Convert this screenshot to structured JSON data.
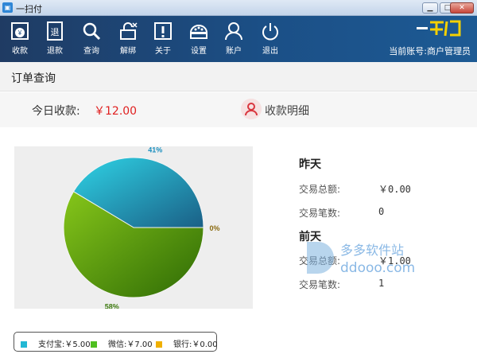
{
  "window": {
    "title": "一扫付",
    "controls": [
      "minimize",
      "maximize",
      "close"
    ]
  },
  "toolbar": {
    "items": [
      {
        "id": "collect",
        "label": "收款",
        "icon": "cash-icon"
      },
      {
        "id": "refund",
        "label": "退款",
        "icon": "refund-icon"
      },
      {
        "id": "query",
        "label": "查询",
        "icon": "search-icon"
      },
      {
        "id": "unbind",
        "label": "解绑",
        "icon": "unbind-icon"
      },
      {
        "id": "about",
        "label": "关于",
        "icon": "info-icon"
      },
      {
        "id": "settings",
        "label": "设置",
        "icon": "settings-icon"
      },
      {
        "id": "account",
        "label": "账户",
        "icon": "user-icon"
      },
      {
        "id": "exit",
        "label": "退出",
        "icon": "power-icon"
      }
    ],
    "brand_text": "一扫付",
    "account_text": "当前账号:商户管理员"
  },
  "page": {
    "title": "订单查询"
  },
  "today": {
    "label": "今日收款:",
    "value": "￥12.00",
    "detail_label": "收款明细"
  },
  "chart_data": {
    "type": "pie",
    "slices": [
      {
        "name": "支付宝",
        "value": 41,
        "label": "41%",
        "color": "#22b8d4"
      },
      {
        "name": "微信",
        "value": 58,
        "label": "58%",
        "color": "#4f9a10"
      },
      {
        "name": "银行",
        "value": 0,
        "label": "0%",
        "color": "#e2b200"
      }
    ],
    "legend": [
      {
        "text": "支付宝:￥5.00",
        "color": "#22b8d4"
      },
      {
        "text": "微信:￥7.00",
        "color": "#4fbf20"
      },
      {
        "text": "银行:￥0.00",
        "color": "#f0b000"
      }
    ]
  },
  "stats": {
    "yesterday": {
      "heading": "昨天",
      "total_label": "交易总额:",
      "total_value": "￥0.00",
      "count_label": "交易笔数:",
      "count_value": "0"
    },
    "day_before": {
      "heading": "前天",
      "total_label": "交易总额:",
      "total_value": "￥1.00",
      "count_label": "交易笔数:",
      "count_value": "1"
    }
  },
  "watermark": {
    "line1": "多多软件站",
    "line2": "ddooo.com"
  },
  "colors": {
    "toolbar": "#1b4f86",
    "accent_red": "#e02020"
  }
}
